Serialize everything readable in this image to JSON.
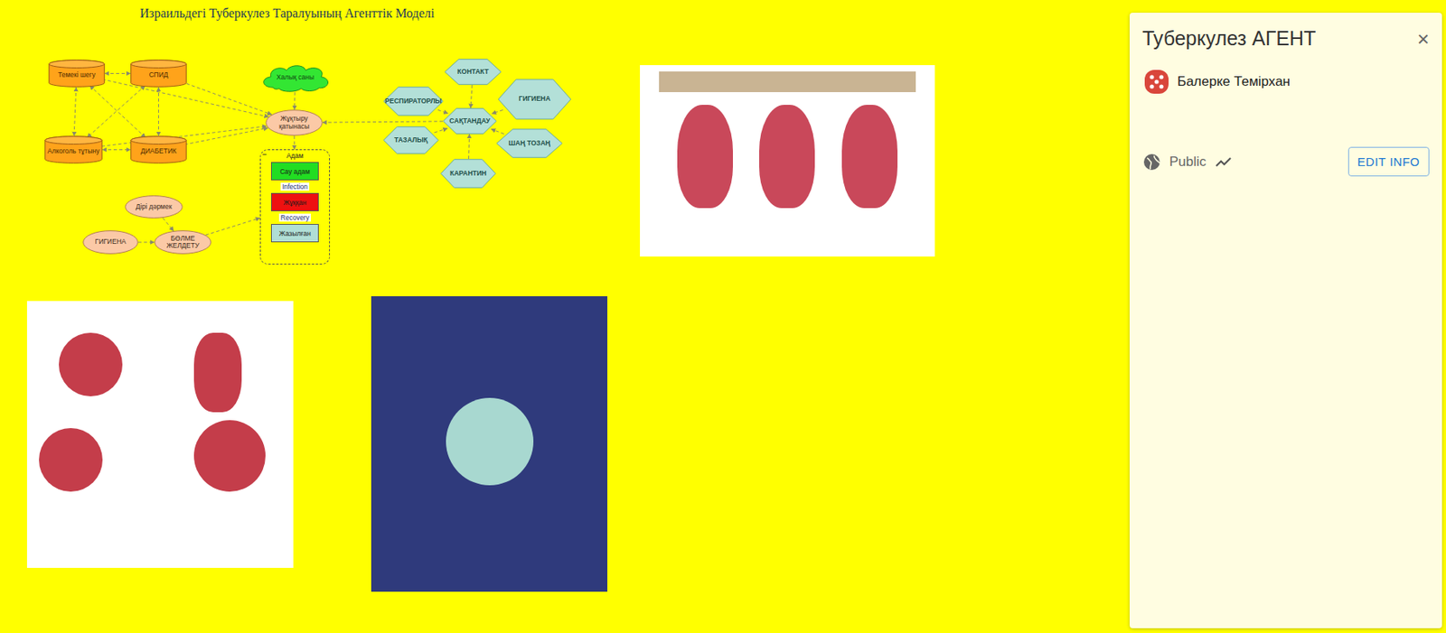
{
  "map": {
    "title": "Израильдегі Туберкулез Таралуының Агенттік Моделі"
  },
  "elements": [
    {
      "label": "Темекі шегу",
      "kind": "cylinder"
    },
    {
      "label": "СПИД",
      "kind": "cylinder"
    },
    {
      "label": "Алкоголь тұтыну",
      "kind": "cylinder"
    },
    {
      "label": "ДИАБЕТИК",
      "kind": "cylinder"
    },
    {
      "label": "Халық саны",
      "kind": "cloud"
    },
    {
      "label": "Жұқтыру қатынасы",
      "kind": "ellipse"
    },
    {
      "label": "КОНТАКТ",
      "kind": "hexagon"
    },
    {
      "label": "РЕСПИРАТОРЛЫ",
      "kind": "hexagon"
    },
    {
      "label": "ГИГИЕНА",
      "kind": "hexagon"
    },
    {
      "label": "САҚТАНДАУ",
      "kind": "hexagon"
    },
    {
      "label": "ТАЗАЛЫҚ",
      "kind": "hexagon"
    },
    {
      "label": "ШАҢ ТОЗАҢ",
      "kind": "hexagon"
    },
    {
      "label": "КАРАНТИН",
      "kind": "hexagon"
    },
    {
      "label": "Дірі дәрмек",
      "kind": "ellipse"
    },
    {
      "label": "ГИГИЕНА",
      "kind": "ellipse"
    },
    {
      "label": "БӨЛМЕ ЖЕЛДЕТУ",
      "kind": "ellipse"
    }
  ],
  "container": {
    "label": "Адам",
    "collapse": "−",
    "states": [
      {
        "label": "Сау адам",
        "color": "#22dd22"
      },
      {
        "label": "Жұққан",
        "color": "#ee1111"
      },
      {
        "label": "Жазылған",
        "color": "#b0ded5"
      }
    ],
    "transitions": [
      "Infection",
      "Recovery"
    ]
  },
  "panel": {
    "title": "Туберкулез АГЕНТ",
    "close": "×",
    "author": "Балерке Темірхан",
    "visibility": "Public",
    "edit_button": "EDIT INFO"
  }
}
